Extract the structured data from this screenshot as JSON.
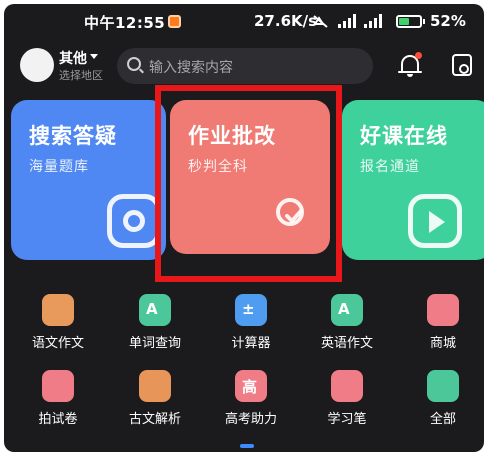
{
  "status_bar": {
    "time": "中午12:55",
    "network_speed": "27.6K/s",
    "battery_percent": "52%",
    "battery_level": 0.52,
    "icons": [
      "mute-icon",
      "signal-hd-icon",
      "signal-hd-icon",
      "wifi-icon",
      "battery-charging-icon"
    ]
  },
  "header": {
    "region_name": "其他",
    "region_sub": "选择地区",
    "search_placeholder": "输入搜索内容",
    "icons": [
      "bell-icon",
      "calculator-icon"
    ]
  },
  "cards": [
    {
      "title": "搜索答疑",
      "subtitle": "海量题库",
      "icon": "camera-icon",
      "color": "#4f88f2"
    },
    {
      "title": "作业批改",
      "subtitle": "秒判全科",
      "icon": "check-circle-icon",
      "color": "#f07b74"
    },
    {
      "title": "好课在线",
      "subtitle": "报名通道",
      "icon": "play-icon",
      "color": "#3fd19b"
    }
  ],
  "tools": [
    {
      "label": "语文作文",
      "icon": "notebook-icon",
      "glyph": "",
      "color": "#e89a5c"
    },
    {
      "label": "单词查询",
      "icon": "word-search-icon",
      "glyph": "A",
      "color": "#4cc79a"
    },
    {
      "label": "计算器",
      "icon": "calculator-icon",
      "glyph": "±",
      "color": "#4f9df0"
    },
    {
      "label": "英语作文",
      "icon": "english-doc-icon",
      "glyph": "A",
      "color": "#4cc79a"
    },
    {
      "label": "商城",
      "icon": "shop-icon",
      "glyph": "",
      "color": "#ef7c86"
    },
    {
      "label": "拍试卷",
      "icon": "exam-scan-icon",
      "glyph": "",
      "color": "#ef7c86"
    },
    {
      "label": "古文解析",
      "icon": "ancient-text-icon",
      "glyph": "",
      "color": "#e8955a"
    },
    {
      "label": "高考助力",
      "icon": "exam-boost-icon",
      "glyph": "高",
      "color": "#ef7c86"
    },
    {
      "label": "学习笔",
      "icon": "pen-icon",
      "glyph": "",
      "color": "#ef7c86"
    },
    {
      "label": "全部",
      "icon": "all-apps-icon",
      "glyph": "",
      "color": "#4cc79a"
    }
  ],
  "accent": {
    "highlight_border": "#e8181a",
    "pager": "#3d8bff"
  }
}
